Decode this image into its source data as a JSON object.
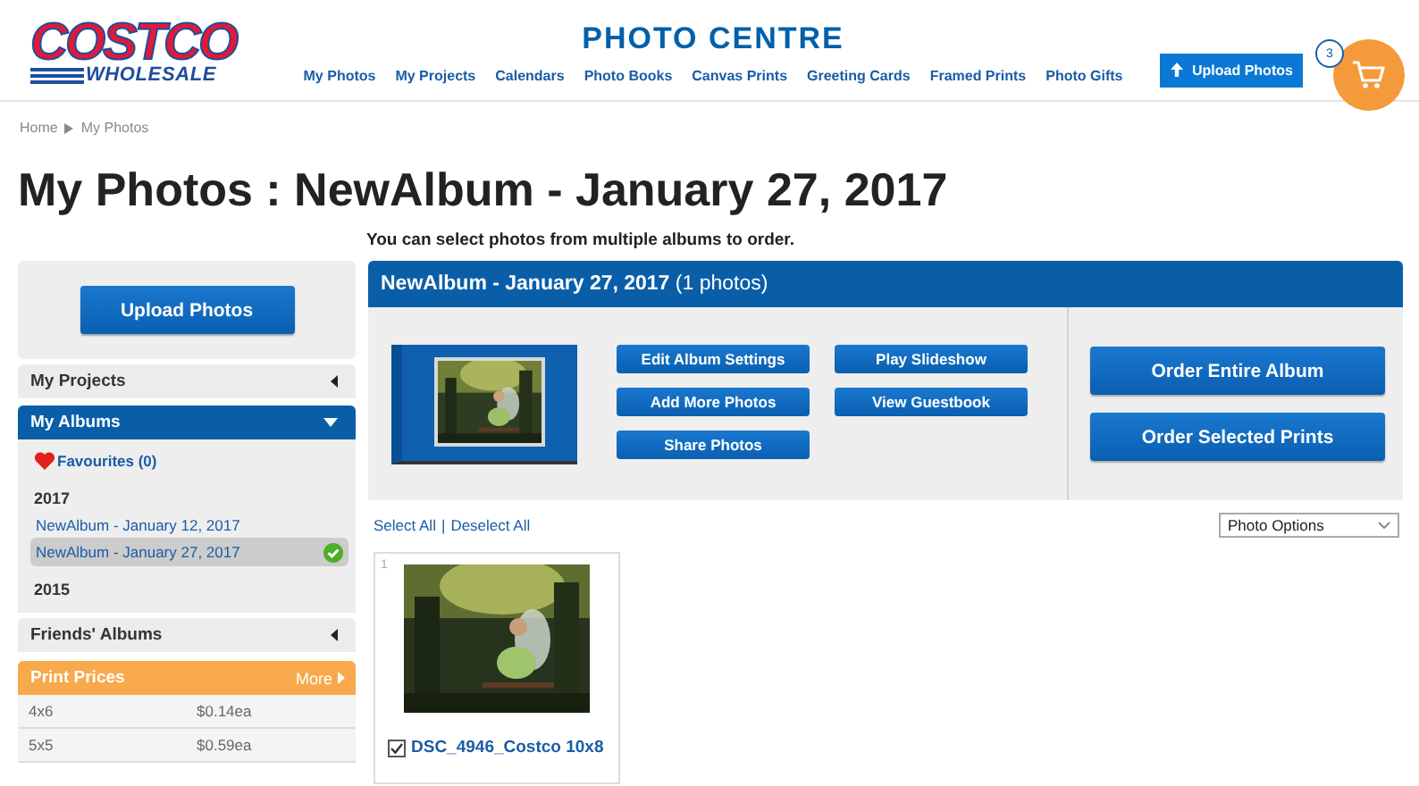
{
  "logo": {
    "wordmark": "COSTCO",
    "tagline": "WHOLESALE"
  },
  "header": {
    "title": "PHOTO CENTRE",
    "nav": [
      "My Photos",
      "My Projects",
      "Calendars",
      "Photo Books",
      "Canvas Prints",
      "Greeting Cards",
      "Framed Prints",
      "Photo Gifts"
    ],
    "upload_button": "Upload Photos",
    "cart_count": "3"
  },
  "breadcrumb": [
    "Home",
    "My Photos"
  ],
  "page_title": "My Photos : NewAlbum - January 27, 2017",
  "notice": "You can select photos from multiple albums to order.",
  "sidebar": {
    "upload_button": "Upload Photos",
    "panels": [
      {
        "title": "My Projects",
        "expanded": false
      },
      {
        "title": "My Albums",
        "expanded": true,
        "favourites": "Favourites (0)",
        "years": [
          {
            "year": "2017",
            "albums": [
              {
                "name": "NewAlbum - January 12, 2017",
                "selected": false
              },
              {
                "name": "NewAlbum - January 27, 2017",
                "selected": true
              }
            ]
          },
          {
            "year": "2015"
          }
        ]
      },
      {
        "title": "Friends' Albums",
        "expanded": false
      }
    ],
    "print_prices": {
      "title": "Print Prices",
      "more": "More",
      "rows": [
        {
          "size": "4x6",
          "price": "$0.14ea"
        },
        {
          "size": "5x5",
          "price": "$0.59ea"
        }
      ]
    }
  },
  "album": {
    "title": "NewAlbum - January 27, 2017",
    "count": "(1 photos)",
    "actions": [
      "Edit Album Settings",
      "Play Slideshow",
      "Add More Photos",
      "View Guestbook",
      "Share Photos"
    ],
    "order_buttons": [
      "Order Entire Album",
      "Order Selected Prints"
    ]
  },
  "selection": {
    "select_all": "Select All",
    "separator": "|",
    "deselect_all": "Deselect All"
  },
  "photo_options": {
    "value": "Photo Options"
  },
  "photos": [
    {
      "index": "1",
      "name": "DSC_4946_Costco 10x8",
      "checked": true
    }
  ]
}
